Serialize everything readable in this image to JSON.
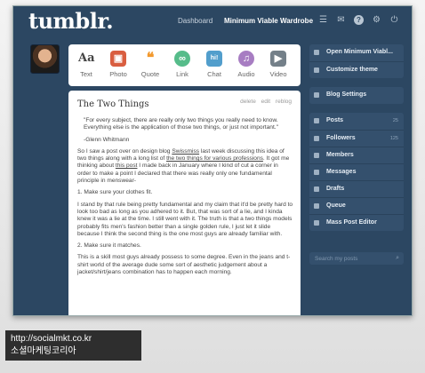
{
  "nav": {
    "logo": "tumblr.",
    "dashboard": "Dashboard",
    "blog_name": "Minimum Viable Wardrobe",
    "icons": [
      "list-icon",
      "mail-icon",
      "help-icon",
      "gear-icon",
      "power-icon"
    ]
  },
  "post_types": [
    {
      "label": "Text",
      "glyph": "Aa",
      "color": "#444444"
    },
    {
      "label": "Photo",
      "glyph": "▣",
      "color": "#d95e40"
    },
    {
      "label": "Quote",
      "glyph": "❝",
      "color": "#f2992e"
    },
    {
      "label": "Link",
      "glyph": "∞",
      "color": "#56bc8a"
    },
    {
      "label": "Chat",
      "glyph": "hi!",
      "color": "#529ecc"
    },
    {
      "label": "Audio",
      "glyph": "♫",
      "color": "#a77dc2"
    },
    {
      "label": "Video",
      "glyph": "▶",
      "color": "#748089"
    }
  ],
  "post": {
    "title": "The Two Things",
    "actions": [
      "delete",
      "edit",
      "reblog"
    ],
    "quote": "\"For every subject, there are really only two things you really need to know. Everything else is the application of those two things, or just not important.\"",
    "quote_author": "-Glenn Whitmann",
    "p1_a": "So I saw a post over on design blog ",
    "p1_link1": "Swissmiss",
    "p1_b": " last week discussing this idea of two things along with a long list of ",
    "p1_link2": "the two things for various professions",
    "p1_c": ". It got me thinking about ",
    "p1_link3": "this post",
    "p1_d": " I made back in January where I kind of cut a corner in order to make a point I declared that there was really only one fundamental principle in menswear-",
    "item1": "1. Make sure your clothes fit.",
    "p2": "I stand by that rule being pretty fundamental and my claim that it'd be pretty hard to look too bad as long as you adhered to it. But, that was sort of a lie, and I kinda knew it was a lie at the time. I still went with it. The truth is that a two things models probably fits men's fashion better than a single golden rule, I just let it slide because I think the second thing is the one most guys are already familiar with.",
    "item2": "2. Make sure it matches.",
    "p3": "This is a skill most guys already possess to some degree. Even in the jeans and t-shirt world of the average dude some sort of aesthetic judgement about a jacket/shirt/jeans combination has to happen each morning."
  },
  "sidebar": {
    "blog_link": "Open Minimum Viabl...",
    "customize": "Customize theme",
    "settings": "Blog Settings",
    "items": [
      {
        "label": "Posts",
        "count": "25"
      },
      {
        "label": "Followers",
        "count": "125"
      },
      {
        "label": "Members",
        "count": ""
      },
      {
        "label": "Messages",
        "count": ""
      },
      {
        "label": "Drafts",
        "count": ""
      },
      {
        "label": "Queue",
        "count": ""
      },
      {
        "label": "Mass Post Editor",
        "count": ""
      }
    ],
    "search_placeholder": "Search my posts"
  },
  "watermark": {
    "line1": "http://socialmkt.co.kr",
    "line2": "소셜마케팅코리아"
  }
}
